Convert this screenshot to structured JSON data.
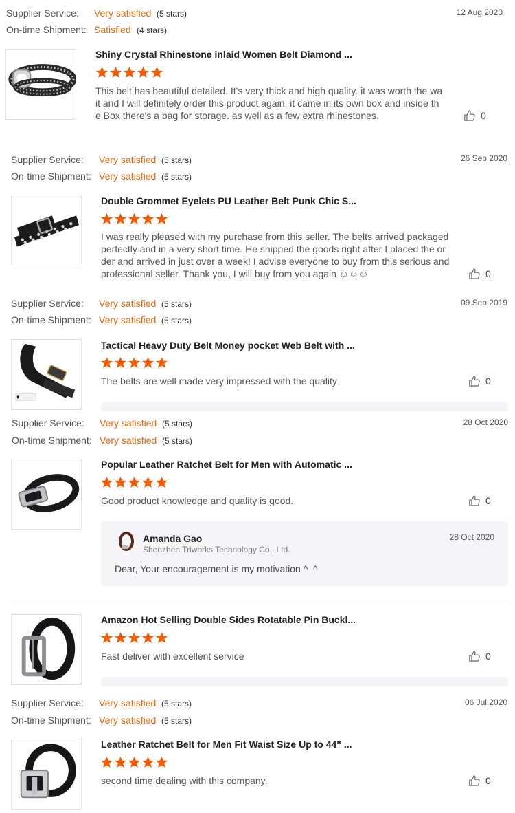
{
  "labels": {
    "supplier_service": "Supplier Service:",
    "ontime_shipment": "On-time Shipment:"
  },
  "reviews": [
    {
      "supplier_service": "Very satisfied",
      "supplier_stars": "(5 stars)",
      "ontime_shipment": "Satisfied",
      "shipment_stars": "(4 stars)",
      "date": "12 Aug 2020",
      "product_title": "Shiny Crystal Rhinestone inlaid Women Belt Diamond ...",
      "rating": 5,
      "text": [
        "This belt has beautiful detailed. It's very thick and high quality. it was worth the wa",
        "it and I will definitely order this product again. it came in its own box and inside th",
        "e Box there's a bag for storage. as well as a few extra rhinestones."
      ],
      "likes": "0"
    },
    {
      "supplier_service": "Very satisfied",
      "supplier_stars": "(5 stars)",
      "ontime_shipment": "Very satisfied",
      "shipment_stars": "(5 stars)",
      "date": "26 Sep 2020",
      "product_title": "Double Grommet Eyelets PU Leather Belt Punk Chic S...",
      "rating": 5,
      "text": [
        "I was really pleased with my purchase from this seller. The belts arrived packaged",
        "perfectly and in a very short time. He shipped the goods right after I placed the or",
        "der and arrived in just over a week! I advise everyone to buy from this serious and",
        "professional seller. Thank you, I will buy from you again ☺☺☺"
      ],
      "likes": "0"
    },
    {
      "supplier_service": "Very satisfied",
      "supplier_stars": "(5 stars)",
      "ontime_shipment": "Very satisfied",
      "shipment_stars": "(5 stars)",
      "date": "09 Sep 2019",
      "product_title": "Tactical Heavy Duty Belt Money pocket Web Belt with ...",
      "rating": 5,
      "text": [
        "The belts are well made very impressed with the quality"
      ],
      "likes": "0"
    },
    {
      "supplier_service": "Very satisfied",
      "supplier_stars": "(5 stars)",
      "ontime_shipment": "Very satisfied",
      "shipment_stars": "(5 stars)",
      "date": "28 Oct 2020",
      "product_title": "Popular Leather Ratchet Belt for Men with Automatic ...",
      "rating": 5,
      "text": [
        "Good product knowledge and quality is good."
      ],
      "likes": "0",
      "reply": {
        "name": "Amanda Gao",
        "company": "Shenzhen Triworks Technology Co., Ltd.",
        "date": "28 Oct 2020",
        "text": "Dear, Your encouragement is my motivation ^_^"
      }
    },
    {
      "product_title": "Amazon Hot Selling Double Sides Rotatable Pin Buckl...",
      "rating": 5,
      "text": [
        "Fast deliver with excellent service"
      ],
      "likes": "0"
    },
    {
      "supplier_service": "Very satisfied",
      "supplier_stars": "(5 stars)",
      "ontime_shipment": "Very satisfied",
      "shipment_stars": "(5 stars)",
      "date": "06 Jul 2020",
      "product_title": "Leather Ratchet Belt for Men Fit Waist Size Up to 44\" ...",
      "rating": 5,
      "text": [
        "second time dealing with this company."
      ],
      "likes": "0"
    }
  ],
  "colors": {
    "accent": "#e8690e",
    "star": "#f25c05",
    "reply_bg": "#f5f5f7",
    "divider": "#e2e2e2"
  },
  "icons": {
    "like": "thumbs-up-icon",
    "star": "star-icon"
  }
}
